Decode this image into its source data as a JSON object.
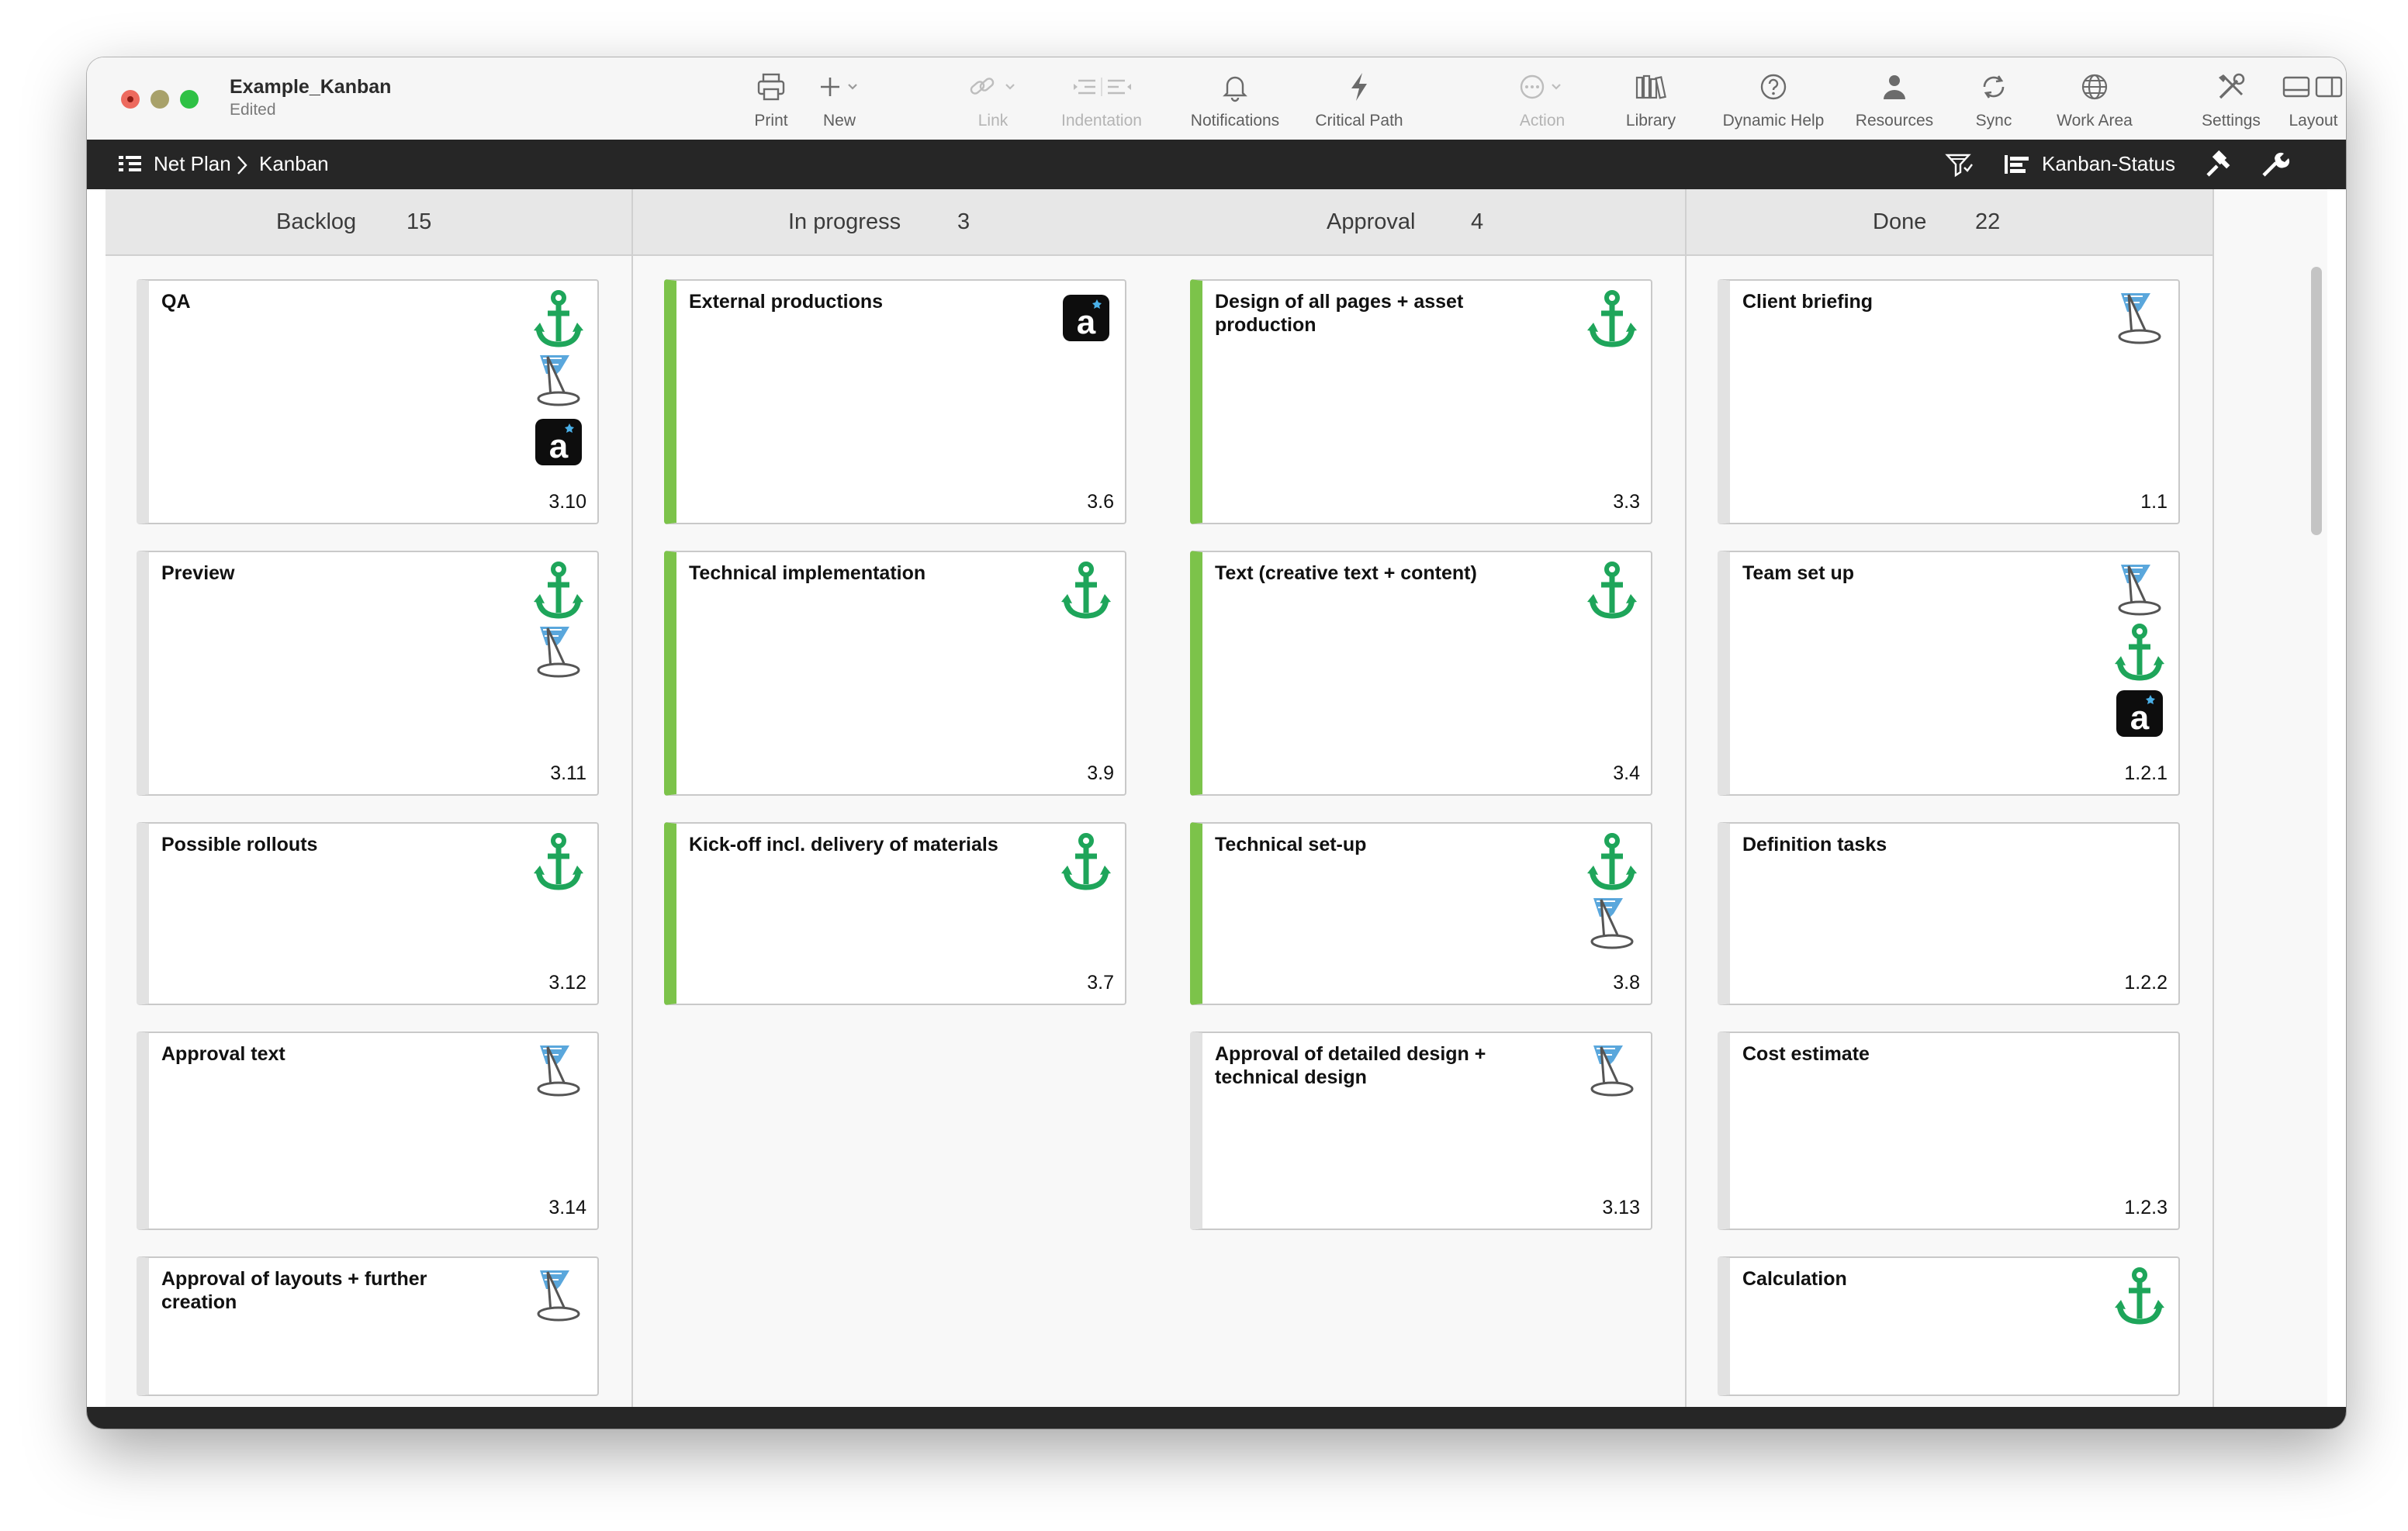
{
  "window": {
    "title": "Example_Kanban",
    "subtitle": "Edited"
  },
  "toolbar": {
    "print": "Print",
    "new": "New",
    "link": "Link",
    "indentation": "Indentation",
    "notifications": "Notifications",
    "critical_path": "Critical Path",
    "action": "Action",
    "library": "Library",
    "dynamic_help": "Dynamic Help",
    "resources": "Resources",
    "sync": "Sync",
    "work_area": "Work Area",
    "settings": "Settings",
    "layout": "Layout"
  },
  "nav": {
    "crumb_root": "Net Plan",
    "crumb_separator": ">",
    "crumb_current": "Kanban",
    "view_selector": "Kanban-Status"
  },
  "colors": {
    "green_bar": "#7cc34a",
    "anchor_green": "#1ea55a",
    "nav_bg": "#262626"
  },
  "columns": [
    {
      "title": "Backlog",
      "count": "15",
      "cards": [
        {
          "title": "QA",
          "number": "3.10",
          "icons": [
            "anchor-icon",
            "wizard-hat-icon",
            "a-app-icon"
          ]
        },
        {
          "title": "Preview",
          "number": "3.11",
          "icons": [
            "anchor-icon",
            "wizard-hat-icon"
          ]
        },
        {
          "title": "Possible rollouts",
          "number": "3.12",
          "icons": [
            "anchor-icon"
          ]
        },
        {
          "title": "Approval text",
          "number": "3.14",
          "icons": [
            "wizard-hat-icon"
          ]
        },
        {
          "title": "Approval of layouts + further creation",
          "number": "",
          "icons": [
            "wizard-hat-icon"
          ]
        }
      ]
    },
    {
      "title": "In progress",
      "count": "3",
      "cards": [
        {
          "title": "External productions",
          "number": "3.6",
          "icons": [
            "a-app-icon"
          ]
        },
        {
          "title": "Technical implementation",
          "number": "3.9",
          "icons": [
            "anchor-icon"
          ]
        },
        {
          "title": "Kick-off incl. delivery of materials",
          "number": "3.7",
          "icons": [
            "anchor-icon"
          ]
        }
      ]
    },
    {
      "title": "Approval",
      "count": "4",
      "cards": [
        {
          "title": "Design of all pages + asset production",
          "number": "3.3",
          "icons": [
            "anchor-icon"
          ]
        },
        {
          "title": "Text (creative text + content)",
          "number": "3.4",
          "icons": [
            "anchor-icon"
          ]
        },
        {
          "title": "Technical set-up",
          "number": "3.8",
          "icons": [
            "anchor-icon",
            "wizard-hat-icon"
          ]
        },
        {
          "title": "Approval of detailed design + technical design",
          "number": "3.13",
          "icons": [
            "wizard-hat-icon"
          ]
        }
      ]
    },
    {
      "title": "Done",
      "count": "22",
      "cards": [
        {
          "title": "Client briefing",
          "number": "1.1",
          "icons": [
            "wizard-hat-icon"
          ]
        },
        {
          "title": "Team set up",
          "number": "1.2.1",
          "icons": [
            "wizard-hat-icon",
            "anchor-icon",
            "a-app-icon"
          ]
        },
        {
          "title": "Definition tasks",
          "number": "1.2.2",
          "icons": []
        },
        {
          "title": "Cost estimate",
          "number": "1.2.3",
          "icons": []
        },
        {
          "title": "Calculation",
          "number": "",
          "icons": [
            "anchor-icon"
          ]
        }
      ]
    }
  ]
}
